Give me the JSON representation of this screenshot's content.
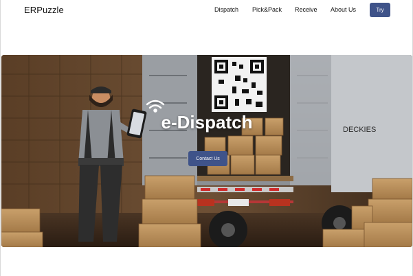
{
  "brand": {
    "name": "ERPuzzle"
  },
  "nav": {
    "links": [
      {
        "label": "Dispatch"
      },
      {
        "label": "Pick&Pack"
      },
      {
        "label": "Receive"
      },
      {
        "label": "About Us"
      }
    ],
    "cta_label": "Try"
  },
  "hero": {
    "title": "e-Dispatch",
    "button_label": "Contact Us",
    "truck_lettering": "DECKIES"
  },
  "colors": {
    "accent": "#3f5389",
    "text": "#111111",
    "background": "#ffffff"
  }
}
